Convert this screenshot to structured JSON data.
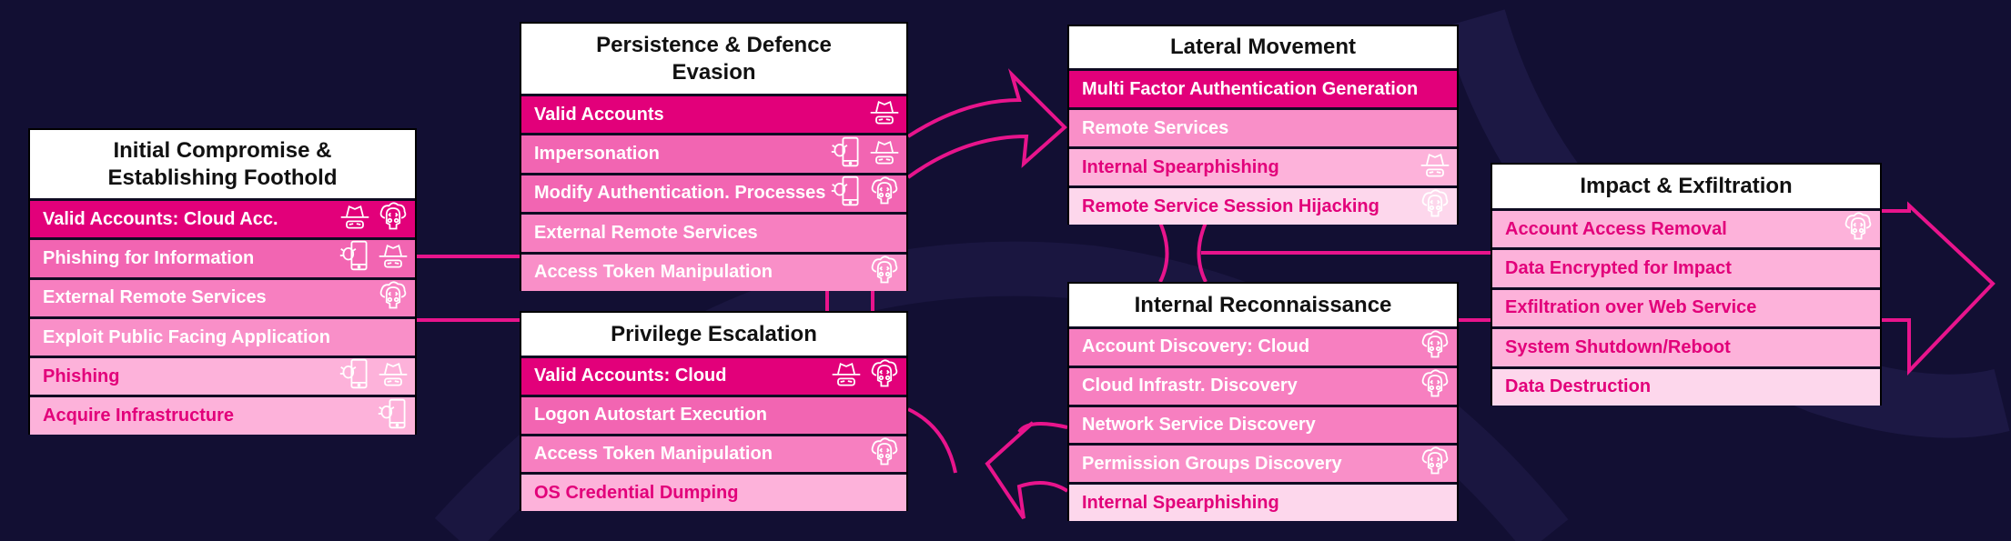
{
  "colors": {
    "background": "#120f33",
    "accent": "#e8148c",
    "tone_dark": "#e2007a",
    "tone_med": "#f265b2",
    "tone_mid": "#f77fc0",
    "tone_soft": "#f98fc8",
    "tone_light": "#fdb2da",
    "tone_lightest": "#fdd7ec"
  },
  "boxes": [
    {
      "id": "initial-compromise",
      "title": "Initial Compromise & Establishing Foothold",
      "rows": [
        {
          "label": "Valid Accounts: Cloud Acc.",
          "tone": "dark",
          "icons": [
            "spy-hat-icon",
            "hacker-skull-icon"
          ]
        },
        {
          "label": "Phishing for Information",
          "tone": "med",
          "icons": [
            "phone-bug-icon",
            "spy-hat-icon"
          ]
        },
        {
          "label": "External Remote Services",
          "tone": "mid",
          "icons": [
            "hacker-skull-icon"
          ]
        },
        {
          "label": "Exploit Public Facing Application",
          "tone": "soft",
          "icons": []
        },
        {
          "label": "Phishing",
          "tone": "light",
          "icons": [
            "phone-bug-icon",
            "spy-hat-icon"
          ]
        },
        {
          "label": "Acquire Infrastructure",
          "tone": "light",
          "icons": [
            "phone-bug-icon"
          ]
        }
      ]
    },
    {
      "id": "persistence",
      "title": "Persistence & Defence Evasion",
      "rows": [
        {
          "label": "Valid Accounts",
          "tone": "dark",
          "icons": [
            "spy-hat-icon"
          ]
        },
        {
          "label": "Impersonation",
          "tone": "med",
          "icons": [
            "phone-bug-icon",
            "spy-hat-icon"
          ]
        },
        {
          "label": "Modify Authentication. Processes",
          "tone": "med",
          "icons": [
            "phone-bug-icon",
            "hacker-skull-icon"
          ]
        },
        {
          "label": "External Remote Services",
          "tone": "mid",
          "icons": []
        },
        {
          "label": "Access Token Manipulation",
          "tone": "soft",
          "icons": [
            "hacker-skull-icon"
          ]
        }
      ]
    },
    {
      "id": "privilege-escalation",
      "title": "Privilege Escalation",
      "rows": [
        {
          "label": "Valid Accounts: Cloud",
          "tone": "dark",
          "icons": [
            "spy-hat-icon",
            "hacker-skull-icon"
          ]
        },
        {
          "label": "Logon Autostart Execution",
          "tone": "med",
          "icons": []
        },
        {
          "label": "Access Token Manipulation",
          "tone": "mid",
          "icons": [
            "hacker-skull-icon"
          ]
        },
        {
          "label": "OS Credential Dumping",
          "tone": "light",
          "icons": []
        }
      ]
    },
    {
      "id": "lateral-movement",
      "title": "Lateral Movement",
      "rows": [
        {
          "label": "Multi Factor Authentication Generation",
          "tone": "dark",
          "icons": []
        },
        {
          "label": "Remote Services",
          "tone": "soft",
          "icons": []
        },
        {
          "label": "Internal Spearphishing",
          "tone": "light",
          "icons": [
            "spy-hat-icon"
          ]
        },
        {
          "label": "Remote Service Session Hijacking",
          "tone": "lightest",
          "icons": [
            "hacker-skull-icon"
          ]
        }
      ]
    },
    {
      "id": "internal-reconnaissance",
      "title": "Internal Reconnaissance",
      "rows": [
        {
          "label": "Account Discovery: Cloud",
          "tone": "mid",
          "icons": [
            "hacker-skull-icon"
          ]
        },
        {
          "label": "Cloud Infrastr. Discovery",
          "tone": "mid",
          "icons": [
            "hacker-skull-icon"
          ]
        },
        {
          "label": "Network Service Discovery",
          "tone": "mid",
          "icons": []
        },
        {
          "label": "Permission Groups Discovery",
          "tone": "soft",
          "icons": [
            "hacker-skull-icon"
          ]
        },
        {
          "label": "Internal Spearphishing",
          "tone": "lightest",
          "icons": []
        }
      ]
    },
    {
      "id": "impact-exfiltration",
      "title": "Impact & Exfiltration",
      "rows": [
        {
          "label": "Account Access Removal",
          "tone": "light",
          "icons": [
            "hacker-skull-icon"
          ]
        },
        {
          "label": "Data Encrypted for Impact",
          "tone": "light",
          "icons": []
        },
        {
          "label": "Exfiltration over Web Service",
          "tone": "light",
          "icons": []
        },
        {
          "label": "System Shutdown/Reboot",
          "tone": "light",
          "icons": []
        },
        {
          "label": "Data Destruction",
          "tone": "lightest",
          "icons": []
        }
      ]
    }
  ]
}
